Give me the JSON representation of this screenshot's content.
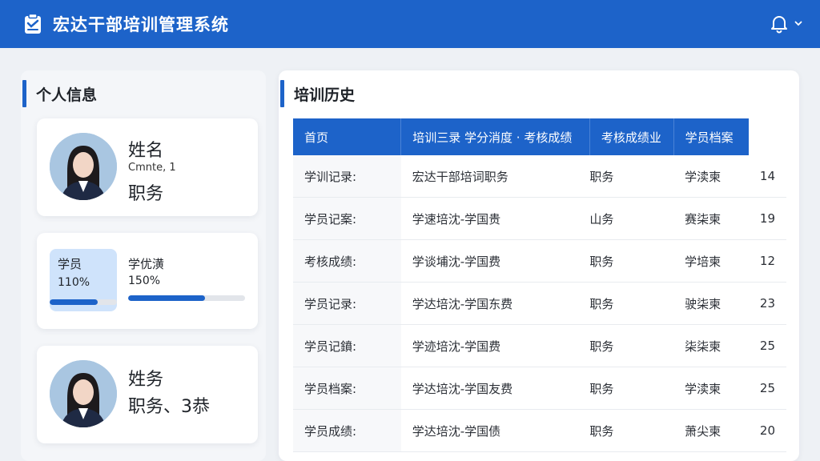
{
  "app": {
    "title": "宏达干部培训管理系统"
  },
  "left": {
    "title": "个人信息",
    "profile": {
      "name_label": "姓名",
      "sub_text": "Cmnte, 1",
      "role_label": "职务"
    },
    "stats": {
      "a_label": "学员",
      "a_value": "110%",
      "a_progress": 0.72,
      "b_label": "学优潢",
      "b_value": "150%",
      "b_progress": 0.66
    },
    "profile2": {
      "line1": "姓务",
      "line2": "职务、3恭"
    }
  },
  "history": {
    "title": "培训历史",
    "columns": [
      "首页",
      "培训三录  学分消度  · 考核成绩",
      "考核成绩业",
      "学员档案"
    ],
    "rows": [
      [
        "学训记录:",
        "宏达干部培词职务",
        "职务",
        "学渎柬",
        "14"
      ],
      [
        "学员记案:",
        "学速培沈-学国贵",
        "山务",
        "赛柒柬",
        "19"
      ],
      [
        "考核成绩:",
        "学谈埔沈-学国费",
        "职务",
        "学培柬",
        "12"
      ],
      [
        "学员记录:",
        "学达培沈-学国东费",
        "职务",
        "驶柒柬",
        "23"
      ],
      [
        "学员记鐼:",
        "学迹培沈-学国费",
        "职务",
        "柒柒柬",
        "25"
      ],
      [
        "学员档案:",
        "学达培沈-学国友费",
        "职务",
        "学渎柬",
        "25"
      ],
      [
        "学员成绩:",
        "学达培沈-学国债",
        "职务",
        "萧尖柬",
        "20"
      ]
    ]
  },
  "colors": {
    "primary": "#1d63c9",
    "stat_box": "#cfe3fb"
  }
}
